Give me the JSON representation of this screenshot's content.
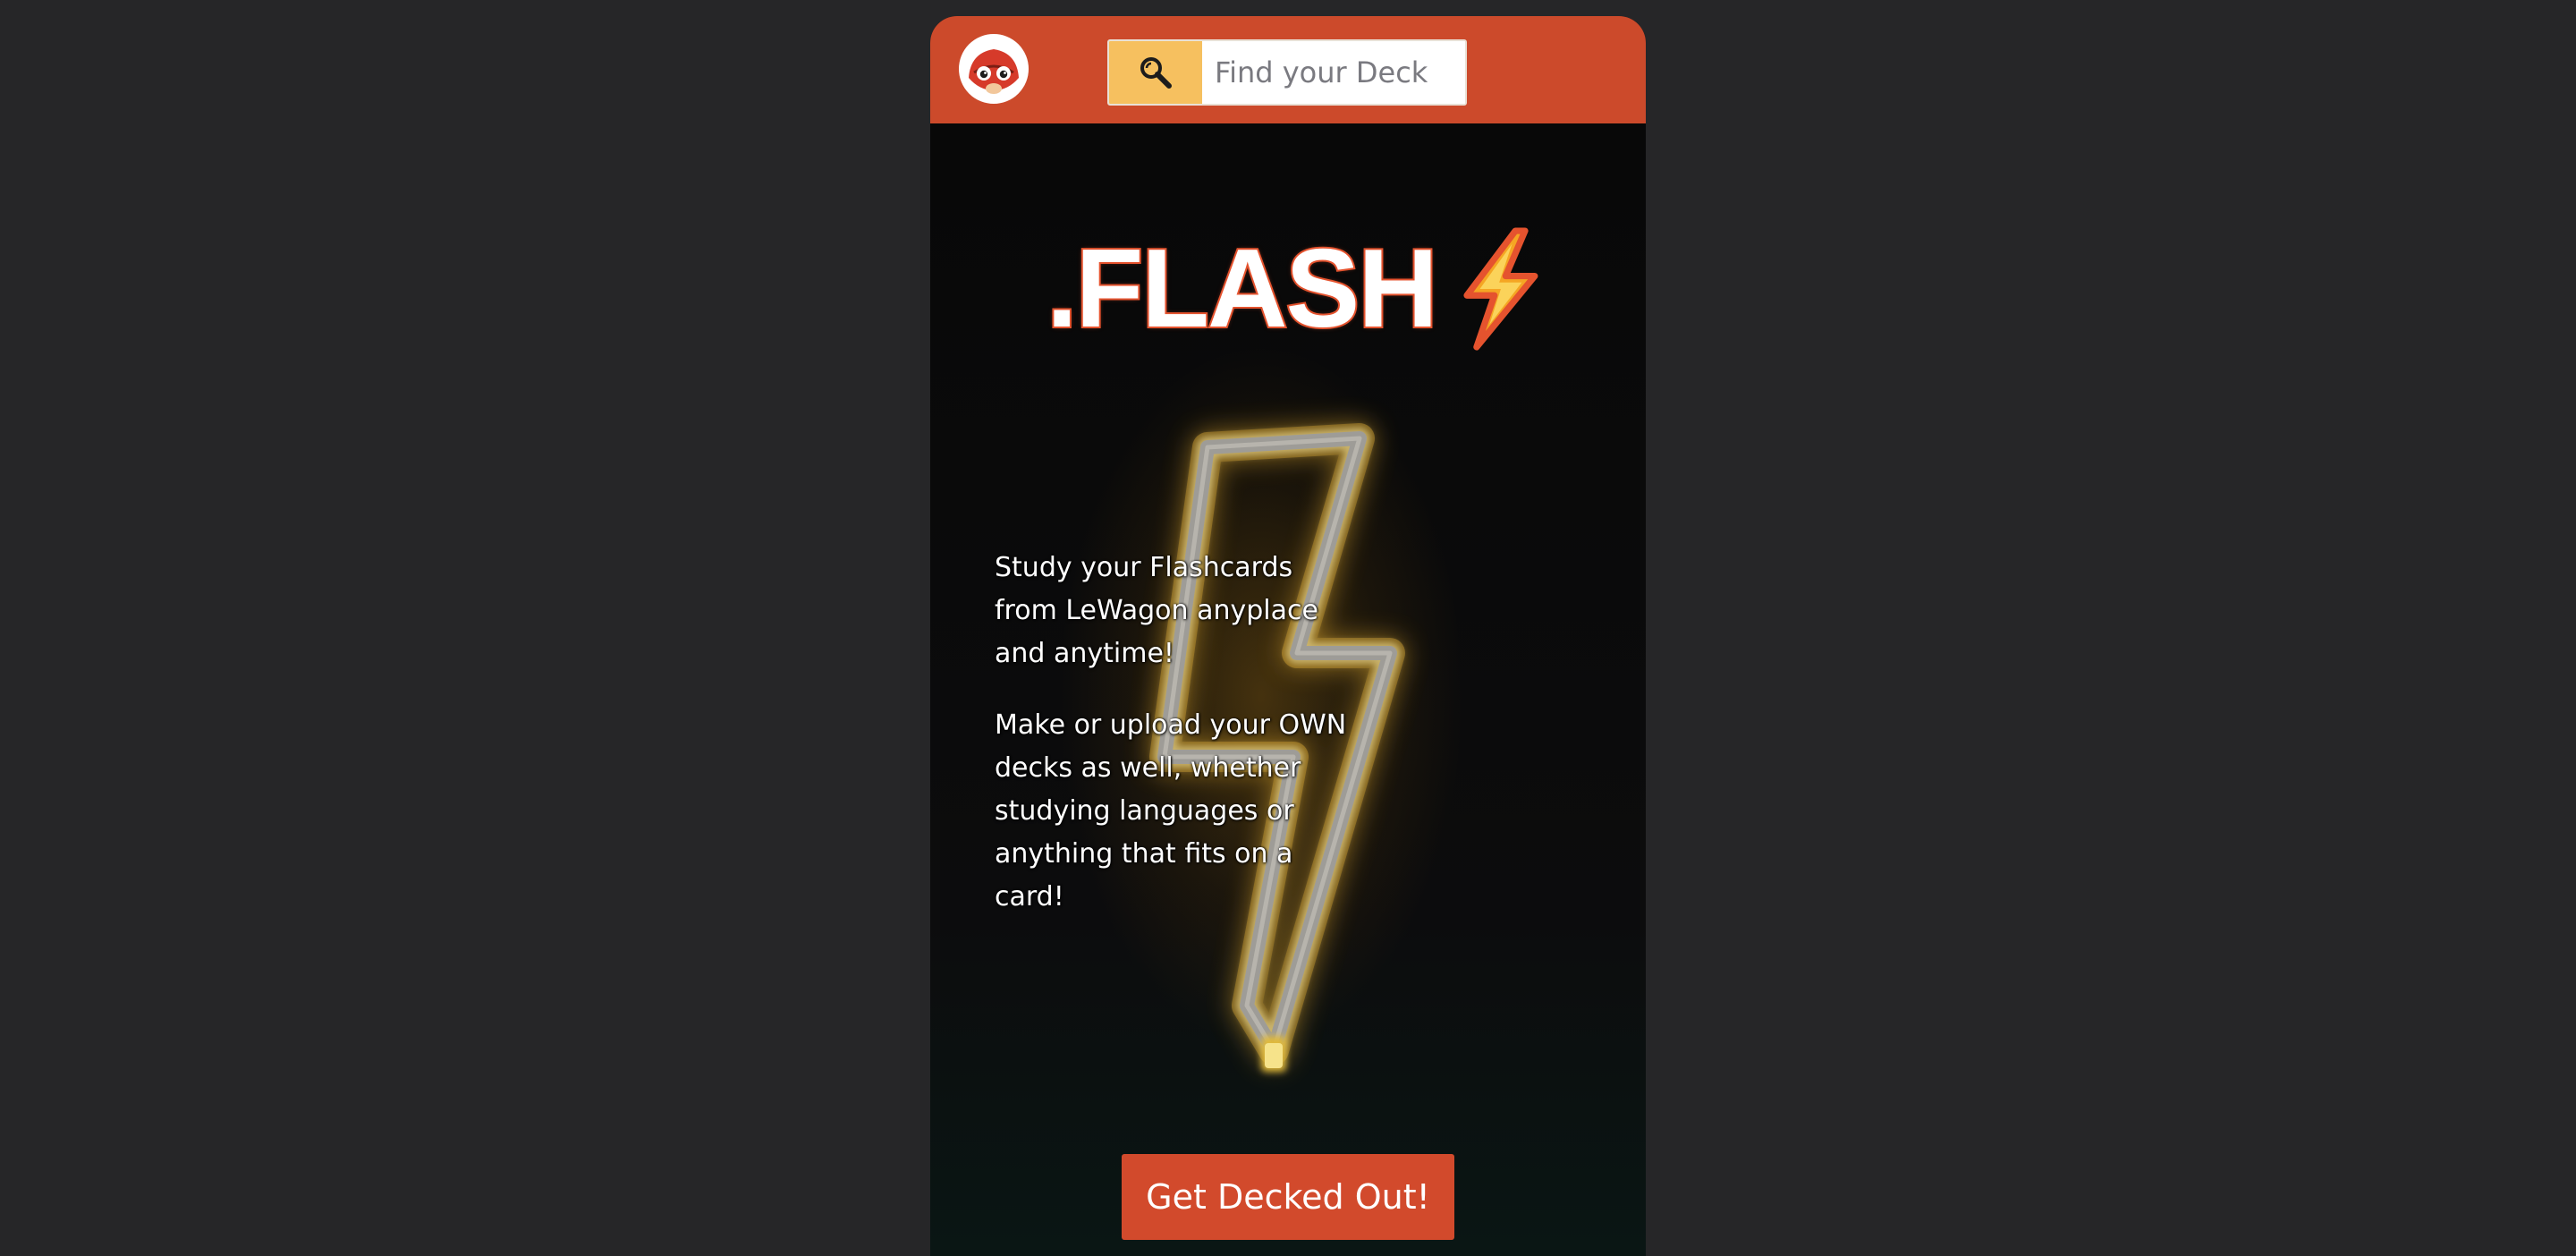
{
  "navbar": {
    "avatar_alt": "Flash mascot logo",
    "search": {
      "icon": "search-icon",
      "placeholder": "Find your Deck",
      "value": ""
    }
  },
  "hero": {
    "brand": ".FLASH",
    "brand_icon": "lightning-bolt-icon",
    "paragraph_1": "Study your Flashcards from LeWagon anyplace and anytime!",
    "paragraph_2": "Make or upload your OWN decks as well, whether studying languages or anything that fits on a card!",
    "cta_label": "Get Decked Out!"
  },
  "colors": {
    "page_background": "#262628",
    "navbar": "#cc4a2b",
    "search_button": "#f6c05f",
    "cta": "#d24a2c",
    "brand_stroke": "#e5532e",
    "neon_bolt": "#f2c23a"
  }
}
